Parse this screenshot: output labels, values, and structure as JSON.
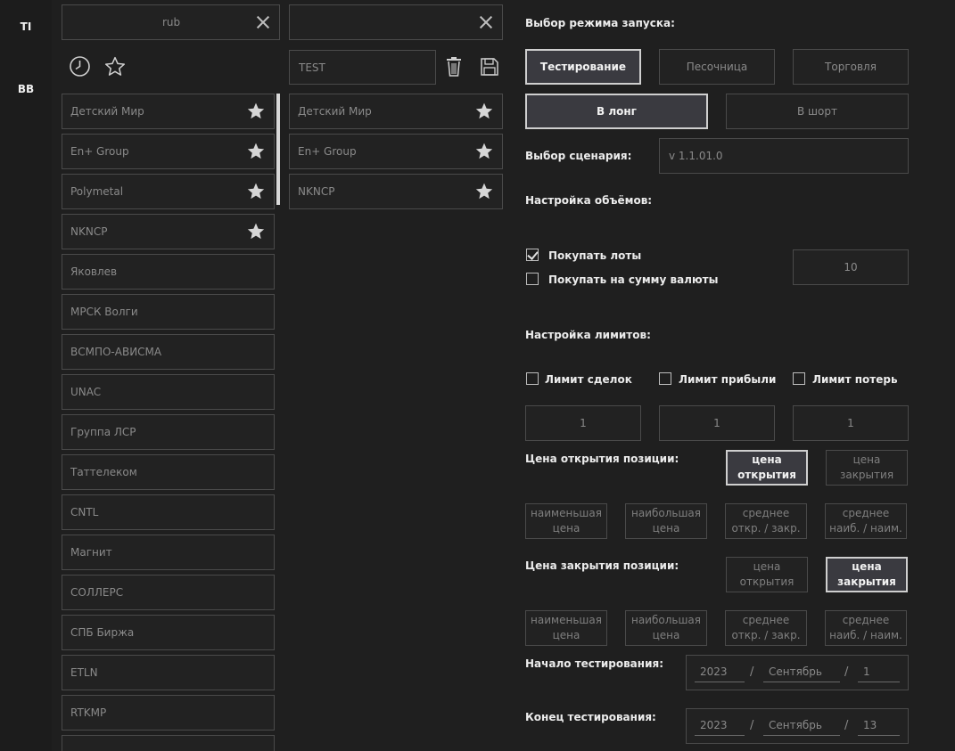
{
  "rail": {
    "items": [
      "TI",
      "BB"
    ]
  },
  "search": {
    "left_value": "rub",
    "right_value": ""
  },
  "tools": {
    "history_icon": "clock-icon",
    "favorites_icon": "star-outline-icon"
  },
  "list_name": {
    "value": "TEST"
  },
  "left_list": [
    {
      "label": "Детский Мир",
      "starred": true
    },
    {
      "label": "En+ Group",
      "starred": true
    },
    {
      "label": "Polymetal",
      "starred": true
    },
    {
      "label": "NKNCP",
      "starred": true
    },
    {
      "label": "Яковлев",
      "starred": false
    },
    {
      "label": "МРСК Волги",
      "starred": false
    },
    {
      "label": "ВСМПО-АВИСМА",
      "starred": false
    },
    {
      "label": "UNAC",
      "starred": false
    },
    {
      "label": "Группа ЛСР",
      "starred": false
    },
    {
      "label": "Таттелеком",
      "starred": false
    },
    {
      "label": "CNTL",
      "starred": false
    },
    {
      "label": "Магнит",
      "starred": false
    },
    {
      "label": "СОЛЛЕРС",
      "starred": false
    },
    {
      "label": "СПБ Биржа",
      "starred": false
    },
    {
      "label": "ETLN",
      "starred": false
    },
    {
      "label": "RTKMP",
      "starred": false
    },
    {
      "label": "",
      "starred": false
    }
  ],
  "right_list": [
    {
      "label": "Детский Мир",
      "starred": true
    },
    {
      "label": "En+ Group",
      "starred": true
    },
    {
      "label": "NKNCP",
      "starred": true
    }
  ],
  "settings": {
    "mode_heading": "Выбор режима запуска:",
    "modes": [
      "Тестирование",
      "Песочница",
      "Торговля"
    ],
    "directions": [
      "В лонг",
      "В шорт"
    ],
    "scenario_heading": "Выбор сценария:",
    "scenario_value": "v 1.1.01.0",
    "volume_heading": "Настройка объёмов:",
    "buy_lots": "Покупать лоты",
    "buy_sum": "Покупать на сумму валюты",
    "volume_value": "10",
    "limits_heading": "Настройка лимитов:",
    "limit_deals": "Лимит сделок",
    "limit_profit": "Лимит прибыли",
    "limit_loss": "Лимит потерь",
    "limit_values": [
      "1",
      "1",
      "1"
    ],
    "open_price_heading": "Цена открытия позиции:",
    "close_price_heading": "Цена закрытия позиции:",
    "price_open_a": "цена",
    "price_open_b": "открытия",
    "price_close_a": "цена",
    "price_close_b": "закрытия",
    "opt_min_a": "наименьшая",
    "opt_min_b": "цена",
    "opt_max_a": "наибольшая",
    "opt_max_b": "цена",
    "opt_avg_oc_a": "среднее",
    "opt_avg_oc_b": "откр. / закр.",
    "opt_avg_hl_a": "среднее",
    "opt_avg_hl_b": "наиб. / наим.",
    "start_heading": "Начало тестирования:",
    "end_heading": "Конец тестирования:",
    "start_date": {
      "year": "2023",
      "month": "Сентябрь",
      "day": "1"
    },
    "end_date": {
      "year": "2023",
      "month": "Сентябрь",
      "day": "13"
    },
    "slash": "/"
  },
  "colors": {
    "background": "#1f1f1f",
    "border": "#4a4a4a",
    "active_fill": "#3a3a40",
    "active_border": "#cfcfcf"
  }
}
